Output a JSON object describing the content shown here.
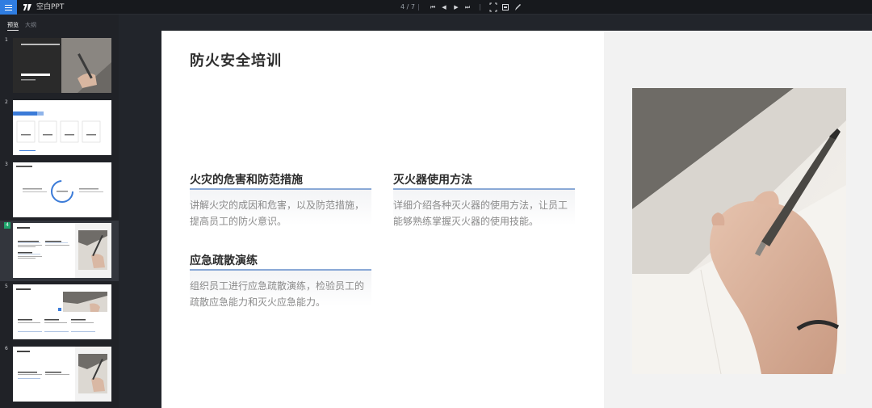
{
  "app": {
    "title": "空白PPT",
    "menu_icon": "menu-icon",
    "logo_icon": "app-logo-icon"
  },
  "player": {
    "page_indicator": "4 / 7",
    "controls": [
      "first-page-icon",
      "prev-page-icon",
      "next-page-icon",
      "last-page-icon",
      "fullscreen-icon",
      "notes-icon",
      "pen-icon"
    ]
  },
  "sidebar": {
    "tabs": [
      {
        "label": "预览",
        "active": true
      },
      {
        "label": "大纲",
        "active": false
      }
    ],
    "thumbnails": [
      {
        "number": "1",
        "selected": false
      },
      {
        "number": "2",
        "selected": false
      },
      {
        "number": "3",
        "selected": false
      },
      {
        "number": "4",
        "selected": true
      },
      {
        "number": "5",
        "selected": false
      },
      {
        "number": "6",
        "selected": false
      }
    ]
  },
  "slide": {
    "title": "防火安全培训",
    "sections": [
      {
        "heading": "火灾的危害和防范措施",
        "body_lines": [
          "讲解火灾的成因和危害，以及防范措施，",
          "提高员工的防火意识。"
        ]
      },
      {
        "heading": "灭火器使用方法",
        "body_lines": [
          "详细介绍各种灭火器的使用方法，让员工",
          "能够熟练掌握灭火器的使用技能。"
        ]
      },
      {
        "heading": "应急疏散演练",
        "body_lines": [
          "组织员工进行应急疏散演练，检验员工的",
          "疏散应急能力和灭火应急能力。"
        ]
      }
    ],
    "image": "hand-writing-with-pen-photo"
  },
  "colors": {
    "accent": "#2f7de1",
    "selected_badge": "#1fa36b",
    "section_underline": "#8aa9d6"
  }
}
